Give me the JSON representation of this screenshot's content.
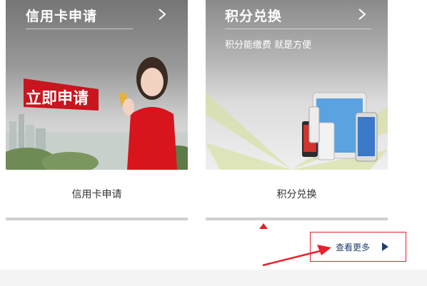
{
  "cards": [
    {
      "title": "信用卡申请",
      "banner_text": "立即申请",
      "caption": "信用卡申请",
      "arrow_icon": "chevron-right-icon"
    },
    {
      "title": "积分兑换",
      "subtitle": "积分能缴费  就是方便",
      "caption": "积分兑换",
      "arrow_icon": "chevron-right-icon"
    }
  ],
  "more_button": {
    "label": "查看更多",
    "icon": "play-triangle-icon"
  },
  "colors": {
    "accent": "#e8202a",
    "link": "#1f3f6e",
    "progress_bar": "#cfcfcf"
  }
}
